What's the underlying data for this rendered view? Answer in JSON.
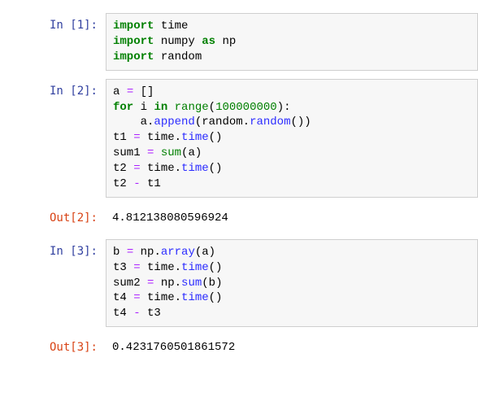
{
  "cells": [
    {
      "in_prompt": "In [1]:",
      "tokens": [
        {
          "t": "import",
          "c": "kw"
        },
        {
          "t": " "
        },
        {
          "t": "time",
          "c": "nm"
        },
        {
          "t": "\n"
        },
        {
          "t": "import",
          "c": "kw"
        },
        {
          "t": " "
        },
        {
          "t": "numpy",
          "c": "nm"
        },
        {
          "t": " "
        },
        {
          "t": "as",
          "c": "kw"
        },
        {
          "t": " "
        },
        {
          "t": "np",
          "c": "nm"
        },
        {
          "t": "\n"
        },
        {
          "t": "import",
          "c": "kw"
        },
        {
          "t": " "
        },
        {
          "t": "random",
          "c": "nm"
        }
      ],
      "out_prompt": null,
      "output": null
    },
    {
      "in_prompt": "In [2]:",
      "tokens": [
        {
          "t": "a",
          "c": "nm"
        },
        {
          "t": " "
        },
        {
          "t": "=",
          "c": "op"
        },
        {
          "t": " "
        },
        {
          "t": "[]",
          "c": "pun"
        },
        {
          "t": "\n"
        },
        {
          "t": "for",
          "c": "kw"
        },
        {
          "t": " "
        },
        {
          "t": "i",
          "c": "nm"
        },
        {
          "t": " "
        },
        {
          "t": "in",
          "c": "kw"
        },
        {
          "t": " "
        },
        {
          "t": "range",
          "c": "bi"
        },
        {
          "t": "(",
          "c": "pun"
        },
        {
          "t": "100000000",
          "c": "num"
        },
        {
          "t": "):",
          "c": "pun"
        },
        {
          "t": "\n"
        },
        {
          "t": "    "
        },
        {
          "t": "a",
          "c": "nm"
        },
        {
          "t": ".",
          "c": "pun"
        },
        {
          "t": "append",
          "c": "fn"
        },
        {
          "t": "(",
          "c": "pun"
        },
        {
          "t": "random",
          "c": "nm"
        },
        {
          "t": ".",
          "c": "pun"
        },
        {
          "t": "random",
          "c": "fn"
        },
        {
          "t": "())",
          "c": "pun"
        },
        {
          "t": "\n"
        },
        {
          "t": "t1",
          "c": "nm"
        },
        {
          "t": " "
        },
        {
          "t": "=",
          "c": "op"
        },
        {
          "t": " "
        },
        {
          "t": "time",
          "c": "nm"
        },
        {
          "t": ".",
          "c": "pun"
        },
        {
          "t": "time",
          "c": "fn"
        },
        {
          "t": "()",
          "c": "pun"
        },
        {
          "t": "\n"
        },
        {
          "t": "sum1",
          "c": "nm"
        },
        {
          "t": " "
        },
        {
          "t": "=",
          "c": "op"
        },
        {
          "t": " "
        },
        {
          "t": "sum",
          "c": "bi"
        },
        {
          "t": "(",
          "c": "pun"
        },
        {
          "t": "a",
          "c": "nm"
        },
        {
          "t": ")",
          "c": "pun"
        },
        {
          "t": "\n"
        },
        {
          "t": "t2",
          "c": "nm"
        },
        {
          "t": " "
        },
        {
          "t": "=",
          "c": "op"
        },
        {
          "t": " "
        },
        {
          "t": "time",
          "c": "nm"
        },
        {
          "t": ".",
          "c": "pun"
        },
        {
          "t": "time",
          "c": "fn"
        },
        {
          "t": "()",
          "c": "pun"
        },
        {
          "t": "\n"
        },
        {
          "t": "t2",
          "c": "nm"
        },
        {
          "t": " "
        },
        {
          "t": "-",
          "c": "op"
        },
        {
          "t": " "
        },
        {
          "t": "t1",
          "c": "nm"
        }
      ],
      "out_prompt": "Out[2]:",
      "output": "4.812138080596924"
    },
    {
      "in_prompt": "In [3]:",
      "tokens": [
        {
          "t": "b",
          "c": "nm"
        },
        {
          "t": " "
        },
        {
          "t": "=",
          "c": "op"
        },
        {
          "t": " "
        },
        {
          "t": "np",
          "c": "nm"
        },
        {
          "t": ".",
          "c": "pun"
        },
        {
          "t": "array",
          "c": "fn"
        },
        {
          "t": "(",
          "c": "pun"
        },
        {
          "t": "a",
          "c": "nm"
        },
        {
          "t": ")",
          "c": "pun"
        },
        {
          "t": "\n"
        },
        {
          "t": "t3",
          "c": "nm"
        },
        {
          "t": " "
        },
        {
          "t": "=",
          "c": "op"
        },
        {
          "t": " "
        },
        {
          "t": "time",
          "c": "nm"
        },
        {
          "t": ".",
          "c": "pun"
        },
        {
          "t": "time",
          "c": "fn"
        },
        {
          "t": "()",
          "c": "pun"
        },
        {
          "t": "\n"
        },
        {
          "t": "sum2",
          "c": "nm"
        },
        {
          "t": " "
        },
        {
          "t": "=",
          "c": "op"
        },
        {
          "t": " "
        },
        {
          "t": "np",
          "c": "nm"
        },
        {
          "t": ".",
          "c": "pun"
        },
        {
          "t": "sum",
          "c": "fn"
        },
        {
          "t": "(",
          "c": "pun"
        },
        {
          "t": "b",
          "c": "nm"
        },
        {
          "t": ")",
          "c": "pun"
        },
        {
          "t": "\n"
        },
        {
          "t": "t4",
          "c": "nm"
        },
        {
          "t": " "
        },
        {
          "t": "=",
          "c": "op"
        },
        {
          "t": " "
        },
        {
          "t": "time",
          "c": "nm"
        },
        {
          "t": ".",
          "c": "pun"
        },
        {
          "t": "time",
          "c": "fn"
        },
        {
          "t": "()",
          "c": "pun"
        },
        {
          "t": "\n"
        },
        {
          "t": "t4",
          "c": "nm"
        },
        {
          "t": " "
        },
        {
          "t": "-",
          "c": "op"
        },
        {
          "t": " "
        },
        {
          "t": "t3",
          "c": "nm"
        }
      ],
      "out_prompt": "Out[3]:",
      "output": "0.4231760501861572"
    }
  ]
}
